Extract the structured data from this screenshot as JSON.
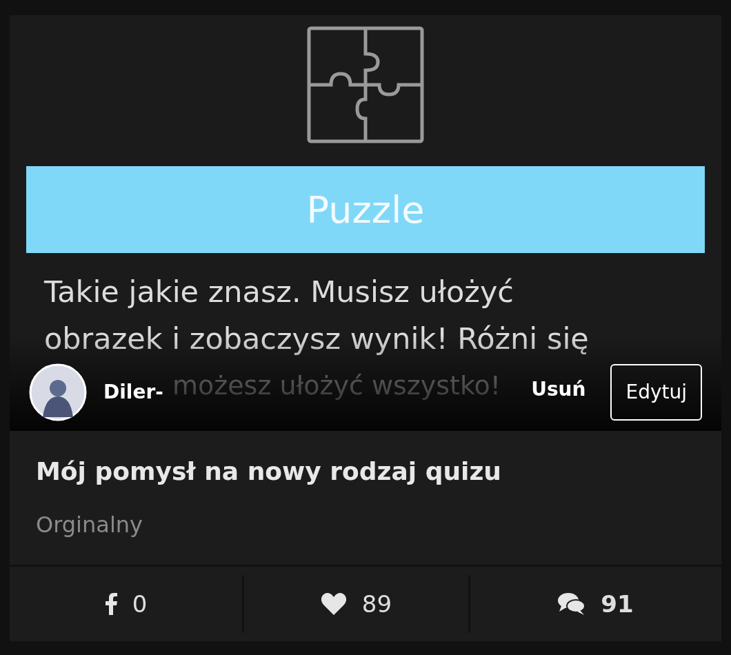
{
  "post_image": {
    "heading": "Puzzle",
    "description_lines": [
      "Takie jakie znasz. Musisz ułożyć",
      "obrazek i zobaczysz wynik! Różni się",
      "możesz ułożyć wszystko!"
    ]
  },
  "author": {
    "name": "Diler-"
  },
  "actions": [
    "Usuń",
    "Edytuj"
  ],
  "title": "Mój pomysł na nowy rodzaj quizu",
  "category": "Orginalny",
  "stats": [
    {
      "kind": "facebook",
      "count": "0"
    },
    {
      "kind": "likes",
      "count": "89"
    },
    {
      "kind": "comments",
      "count": "91"
    }
  ]
}
